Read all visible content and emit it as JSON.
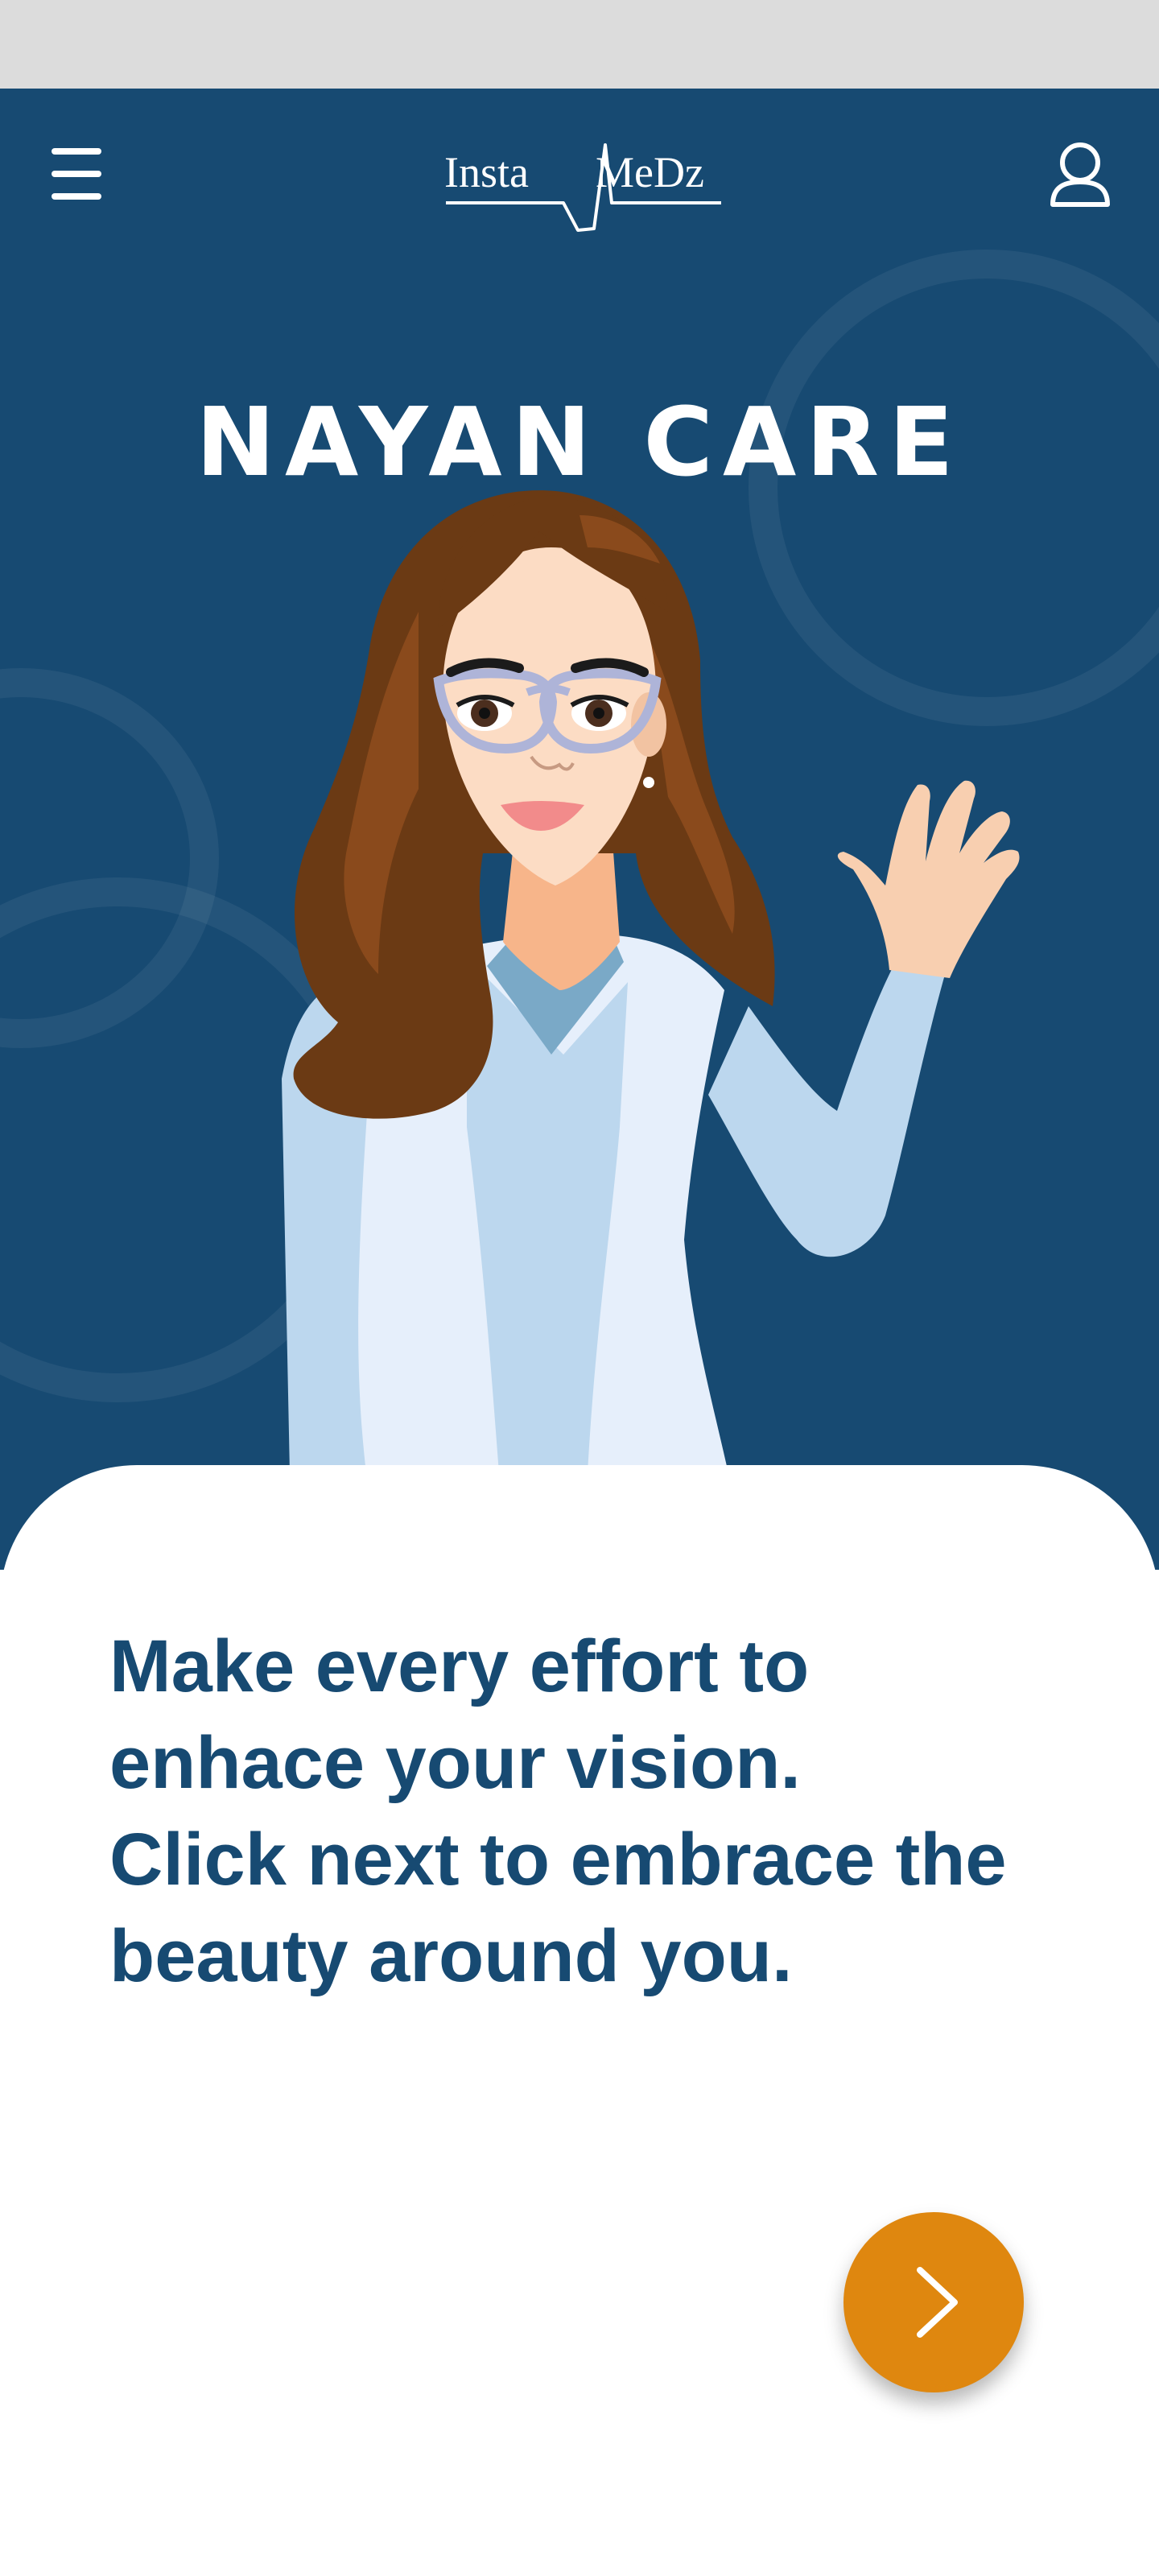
{
  "header": {
    "logo_left": "Insta",
    "logo_right": "MeDz",
    "menu_icon": "hamburger-menu-icon",
    "profile_icon": "user-profile-icon"
  },
  "hero": {
    "title": "NAYAN CARE",
    "illustration": "waving-female-doctor-with-glasses"
  },
  "content": {
    "message_lines": [
      "Make every effort to",
      "enhace your vision.",
      "Click next to embrace the",
      "beauty around you."
    ],
    "next_icon": "chevron-right-icon"
  },
  "colors": {
    "status_bar": "#dcdcdc",
    "hero_background": "#174a72",
    "text_primary": "#174a72",
    "accent": "#df870f",
    "card_background": "#ffffff"
  }
}
